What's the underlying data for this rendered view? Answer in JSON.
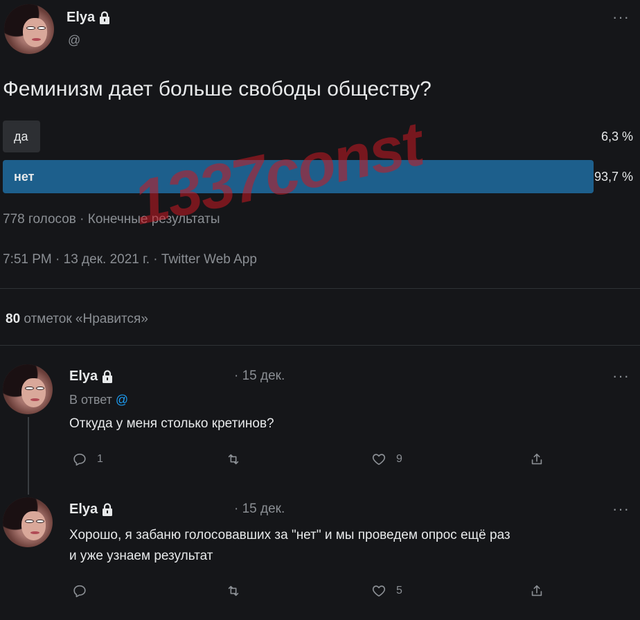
{
  "tweet": {
    "author": "Elya",
    "handle": "@",
    "question": "Феминизм дает больше свободы обществу?",
    "poll": {
      "options": [
        {
          "label": "да",
          "percent_text": "6,3 %",
          "percent": 6.3
        },
        {
          "label": "нет",
          "percent_text": "93,7 %",
          "percent": 93.7
        }
      ],
      "summary": "778 голосов · Конечные результаты"
    },
    "timestamp": "7:51 PM · 13 дек. 2021 г. · Twitter Web App",
    "likes_count": "80",
    "likes_label": "отметок «Нравится»"
  },
  "watermark": "1337const",
  "replies": [
    {
      "author": "Elya",
      "date": "· 15 дек.",
      "reply_to_label": "В ответ",
      "reply_to_handle": "@",
      "text": "Откуда у меня столько кретинов?",
      "reply_count": "1",
      "retweet_count": "",
      "like_count": "9"
    },
    {
      "author": "Elya",
      "date": "· 15 дек.",
      "text_line1": "Хорошо, я забаню голосовавших за \"нет\" и мы проведем опрос ещё раз",
      "text_line2": "и уже узнаем результат",
      "reply_count": "",
      "retweet_count": "",
      "like_count": "5"
    }
  ],
  "icons": {
    "lock": "lock-icon",
    "more": "more-dots-icon",
    "reply": "reply-icon",
    "retweet": "retweet-icon",
    "like": "heart-icon",
    "share": "share-icon"
  },
  "colors": {
    "background": "#151619",
    "poll_winner": "#1d5f8c",
    "poll_other": "#2d2f33",
    "muted": "#8b8f94",
    "link": "#1d9bf0",
    "watermark": "#c81923"
  }
}
